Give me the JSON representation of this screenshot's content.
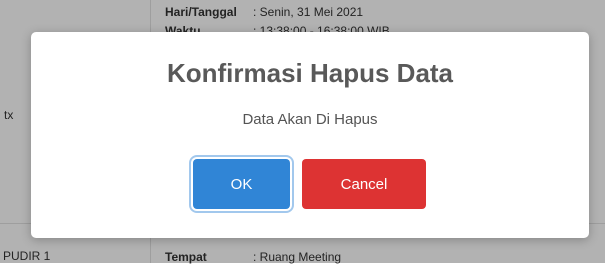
{
  "background": {
    "hari_tanggal_label": "Hari/Tanggal",
    "hari_tanggal_value": ": Senin, 31 Mei 2021",
    "waktu_label": "Waktu",
    "waktu_value": ": 13:38:00 - 16:38:00 WIB",
    "left_fragment_top": "tx",
    "left_fragment_bottom": "PUDIR 1",
    "tempat_label": "Tempat",
    "tempat_value": ": Ruang Meeting"
  },
  "modal": {
    "title": "Konfirmasi Hapus Data",
    "text": "Data Akan Di Hapus",
    "ok_label": "OK",
    "cancel_label": "Cancel"
  },
  "colors": {
    "ok_button": "#3085d6",
    "cancel_button": "#dd3333",
    "overlay": "rgba(0,0,0,0.30)"
  }
}
